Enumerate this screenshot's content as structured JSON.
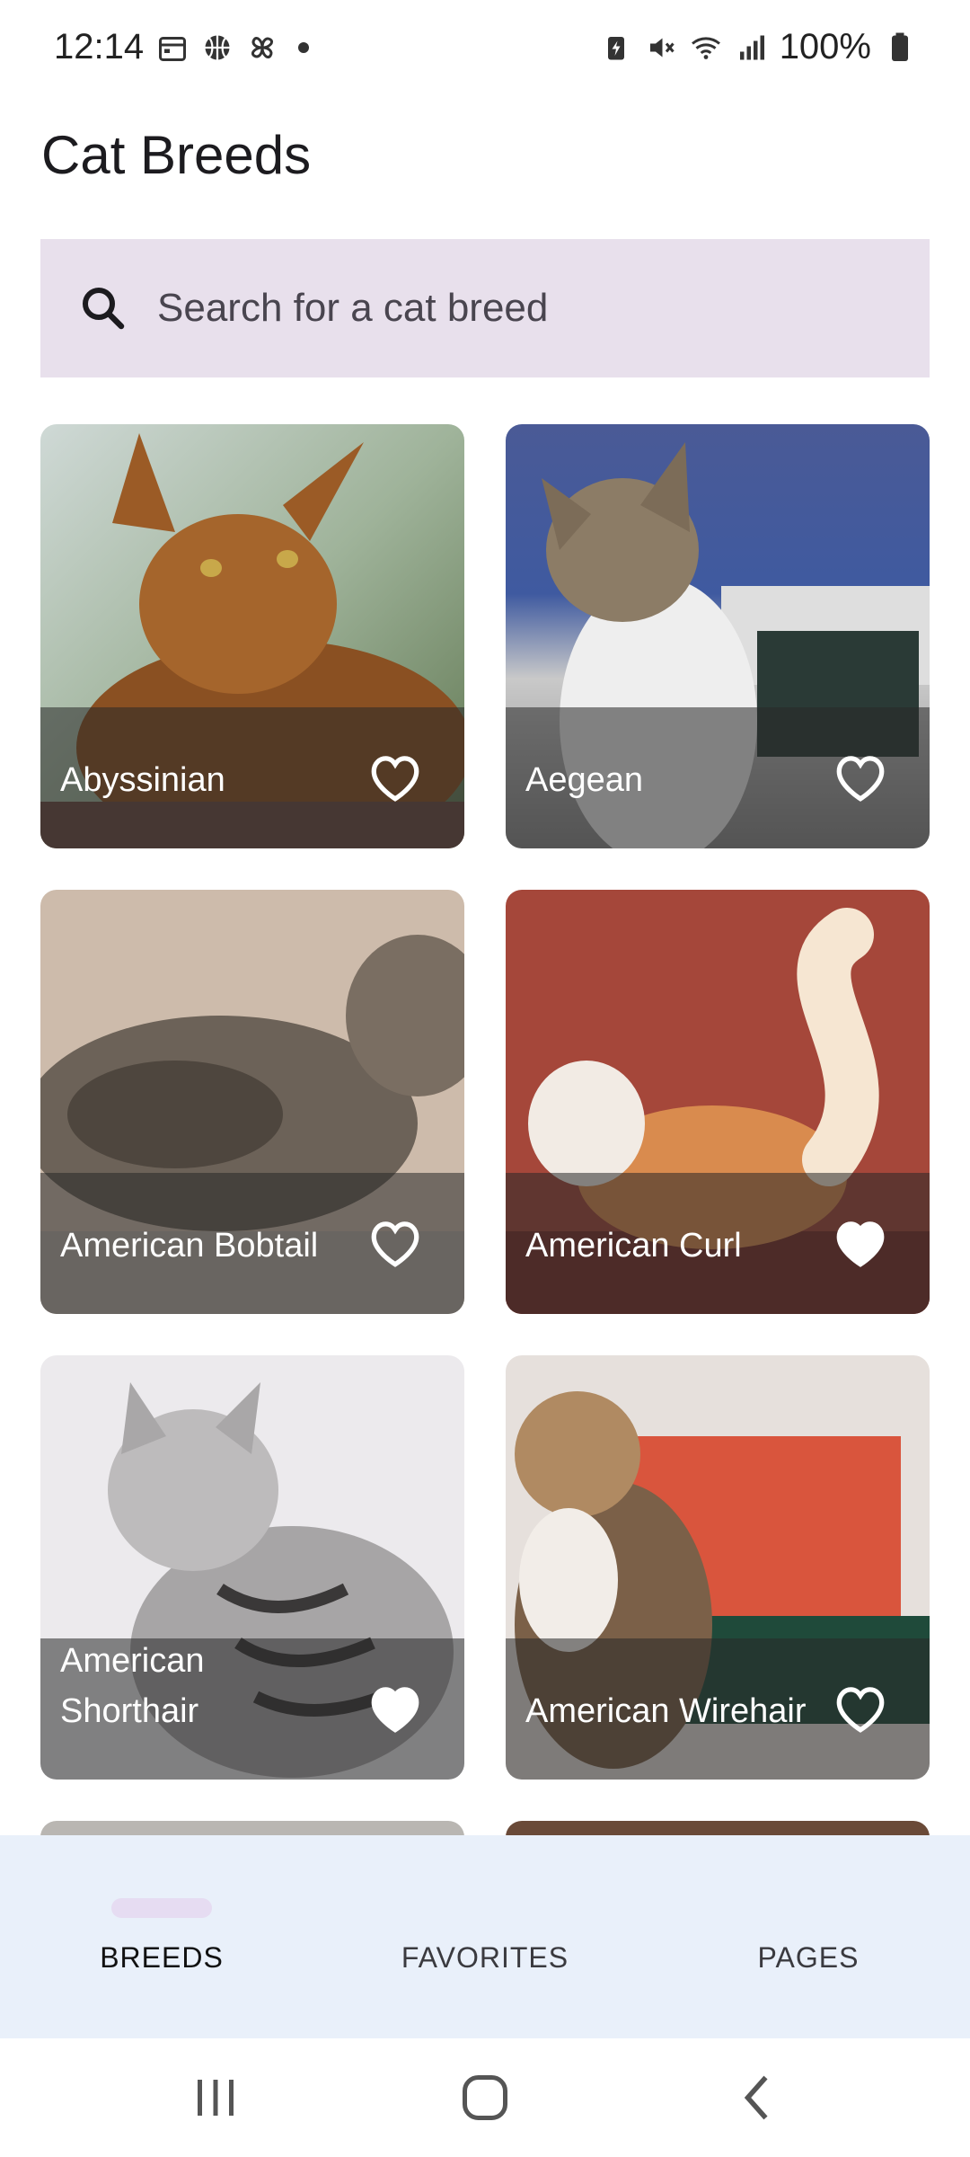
{
  "status_bar": {
    "time": "12:14",
    "battery": "100%",
    "icons_left": [
      "calendar-icon",
      "basketball-icon",
      "pinwheel-icon",
      "notification-dot"
    ],
    "icons_right": [
      "battery-saver-icon",
      "mute-icon",
      "wifi-icon",
      "signal-icon",
      "battery-icon"
    ]
  },
  "app": {
    "title": "Cat Breeds"
  },
  "search": {
    "placeholder": "Search for a cat breed",
    "icon": "search-icon"
  },
  "breeds": [
    {
      "name": "Abyssinian",
      "favorite": false
    },
    {
      "name": "Aegean",
      "favorite": false
    },
    {
      "name": "American Bobtail",
      "favorite": false
    },
    {
      "name": "American Curl",
      "favorite": true
    },
    {
      "name": "American Shorthair",
      "favorite": true
    },
    {
      "name": "American Wirehair",
      "favorite": false
    }
  ],
  "bottom_nav": {
    "items": [
      {
        "label": "BREEDS",
        "active": true
      },
      {
        "label": "FAVORITES",
        "active": false
      },
      {
        "label": "PAGES",
        "active": false
      }
    ]
  },
  "colors": {
    "search_bg": "#e8e0ec",
    "nav_bg": "#e9f0fa",
    "nav_indicator": "#e6dcf2",
    "overlay": "rgba(40,40,40,0.55)"
  }
}
